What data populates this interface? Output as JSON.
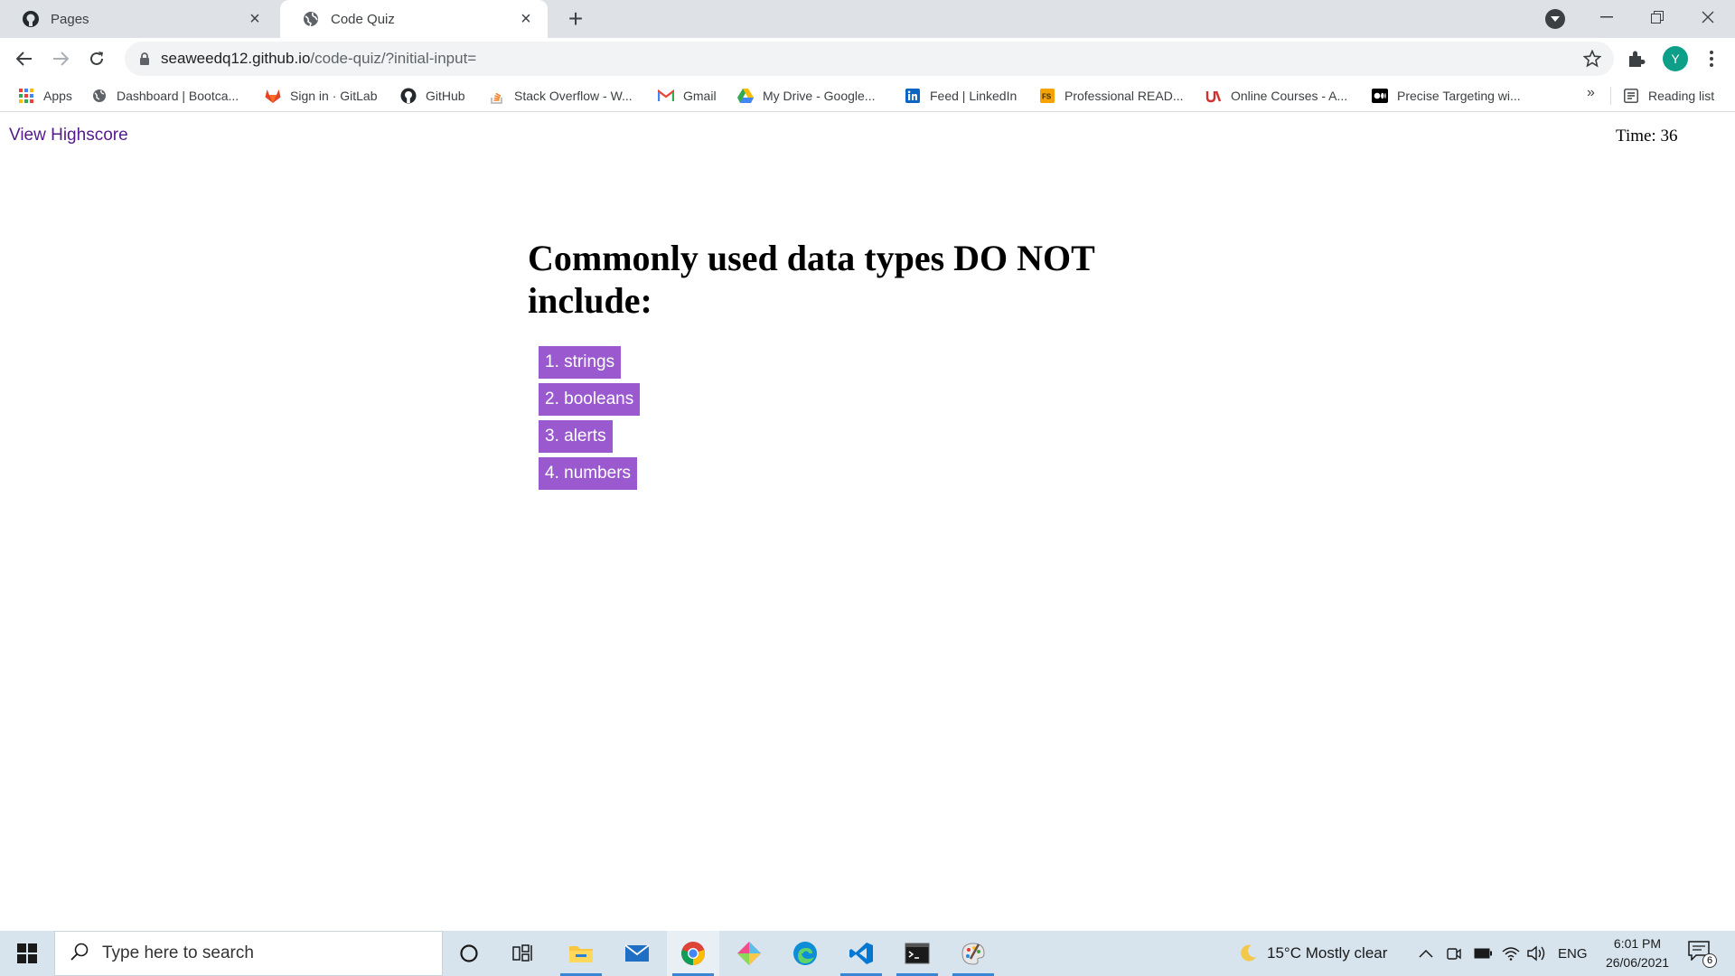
{
  "browser": {
    "tabs": [
      {
        "title": "Pages",
        "active": false
      },
      {
        "title": "Code Quiz",
        "active": true
      }
    ],
    "url_host": "seaweedq12.github.io",
    "url_path": "/code-quiz/?initial-input=",
    "profile_initial": "Y",
    "bookmarks": [
      {
        "label": "Apps"
      },
      {
        "label": "Dashboard | Bootca..."
      },
      {
        "label": "Sign in · GitLab"
      },
      {
        "label": "GitHub"
      },
      {
        "label": "Stack Overflow - W..."
      },
      {
        "label": "Gmail"
      },
      {
        "label": "My Drive - Google..."
      },
      {
        "label": "Feed | LinkedIn"
      },
      {
        "label": "Professional READ..."
      },
      {
        "label": "Online Courses - A..."
      },
      {
        "label": "Precise Targeting wi..."
      }
    ],
    "bookmarks_overflow": "»",
    "reading_list": "Reading list"
  },
  "page": {
    "highscore_link": "View Highscore",
    "timer": "Time: 36",
    "question": "Commonly used data types DO NOT include:",
    "answers": [
      "1. strings",
      "2. booleans",
      "3. alerts",
      "4. numbers"
    ],
    "answer_color": "#9b59d0"
  },
  "taskbar": {
    "search_placeholder": "Type here to search",
    "weather": "15°C  Mostly clear",
    "language": "ENG",
    "time": "6:01 PM",
    "date": "26/06/2021",
    "notification_count": "6"
  }
}
